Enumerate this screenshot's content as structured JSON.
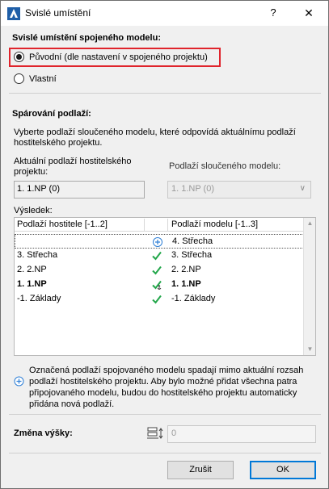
{
  "window": {
    "title": "Svislé umístění",
    "help_label": "?",
    "close_label": "✕"
  },
  "placement": {
    "heading": "Svislé umístění spojeného modelu:",
    "option_original": "Původní (dle nastavení v spojeného projektu)",
    "option_custom": "Vlastní",
    "selected": "original",
    "highlight_color": "#e0242c"
  },
  "pairing": {
    "heading": "Spárování podlaží:",
    "description": "Vyberte podlaží sloučeného modelu, které odpovídá aktuálnímu podlaží hostitelského projektu.",
    "host_label": "Aktuální podlaží hostitelského projektu:",
    "host_value": "1. 1.NP (0)",
    "model_label": "Podlaží sloučeného modelu:",
    "model_value": "1. 1.NP (0)",
    "result_label": "Výsledek:"
  },
  "result_table": {
    "col_host": "Podlaží hostitele [-1..2]",
    "col_model": "Podlaží modelu [-1..3]",
    "rows": [
      {
        "host": "",
        "status": "add-icon",
        "model": "4. Střecha",
        "selected": true,
        "bold": false
      },
      {
        "host": "3. Střecha",
        "status": "check-icon",
        "model": "3. Střecha",
        "selected": false,
        "bold": false
      },
      {
        "host": "2. 2.NP",
        "status": "check-icon",
        "model": "2. 2.NP",
        "selected": false,
        "bold": false
      },
      {
        "host": "1. 1.NP",
        "status": "check-anchor-icon",
        "model": "1. 1.NP",
        "selected": false,
        "bold": true
      },
      {
        "host": "-1. Základy",
        "status": "check-icon",
        "model": "-1. Základy",
        "selected": false,
        "bold": false
      }
    ],
    "check_color": "#22a64a",
    "add_color": "#2e7fd6"
  },
  "note": {
    "text": "Označená podlaží spojovaného modelu spadají mimo aktuální rozsah podlaží hostitelského projektu. Aby bylo možné přidat všechna patra připojovaného modelu, budou do hostitelského projektu automaticky přidána nová podlaží."
  },
  "height_change": {
    "label": "Změna výšky:",
    "value": "0"
  },
  "buttons": {
    "cancel": "Zrušit",
    "ok": "OK"
  }
}
